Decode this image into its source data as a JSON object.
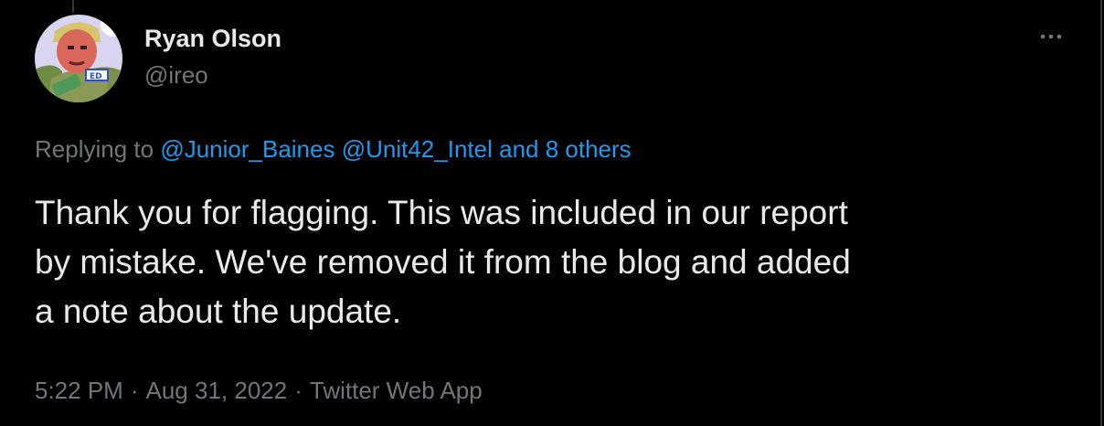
{
  "colors": {
    "background": "#000000",
    "primary_text": "#e7e9ea",
    "secondary_text": "#71767b",
    "link": "#1d9bf0"
  },
  "author": {
    "display_name": "Ryan Olson",
    "handle": "@ireo",
    "avatar_icon": "cartoon-portrait-avatar"
  },
  "more_icon": "ellipsis-icon",
  "replying": {
    "prefix": "Replying to",
    "mentions": [
      "@Junior_Baines",
      "@Unit42_Intel"
    ],
    "others": "and 8 others"
  },
  "tweet": {
    "lines": [
      "Thank you for flagging. This was included in our report",
      "by mistake. We've removed it from the blog and added",
      "a note about the update."
    ]
  },
  "meta": {
    "time": "5:22 PM",
    "date": "Aug 31, 2022",
    "source": "Twitter Web App",
    "separator": "·"
  }
}
